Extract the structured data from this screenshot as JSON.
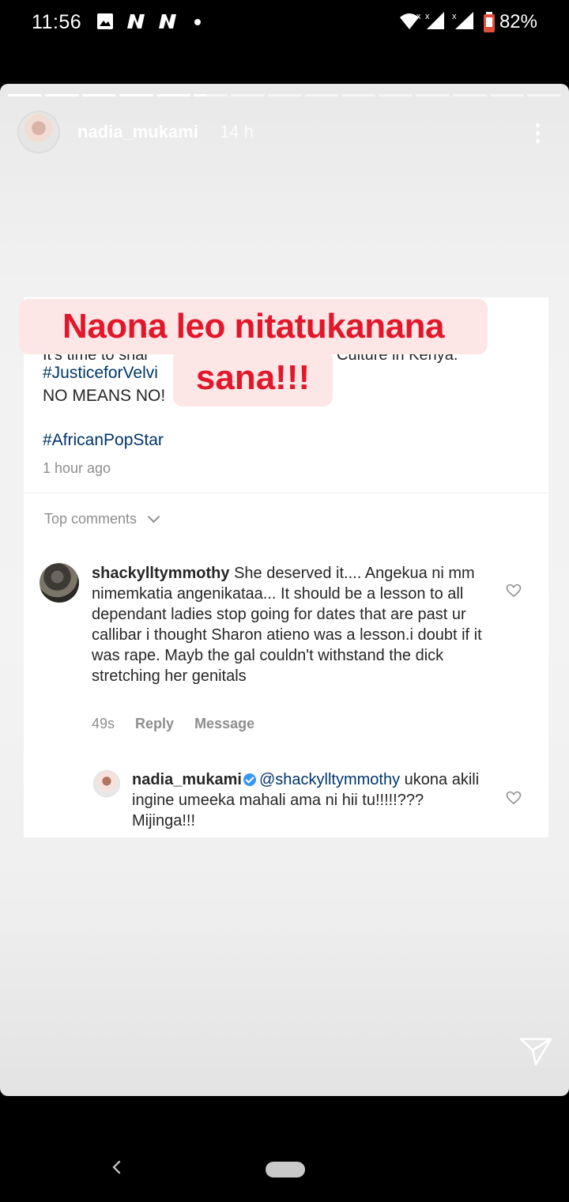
{
  "status_bar": {
    "time": "11:56",
    "battery": "82%",
    "icons": [
      "image-icon",
      "n-app-icon",
      "n-app-icon",
      "dot-icon",
      "wifi-icon",
      "signal-icon",
      "signal-icon",
      "battery-icon"
    ]
  },
  "story": {
    "progress": {
      "segments": 15,
      "completed": 5,
      "current_fill": 0.4
    },
    "username": "nadia_mukami",
    "time_ago": "14 h"
  },
  "post": {
    "hidden_line_left": "It's time to shar",
    "hidden_line_right": "Culture in Kenya.",
    "hashtag1": "#JusticeforVelvi",
    "no_means_no": "NO MEANS NO!",
    "hashtag2": "#AfricanPopStar",
    "time": "1 hour ago",
    "top_comments_label": "Top comments"
  },
  "comments": [
    {
      "username": "shackylltymmothy",
      "text": "She deserved it.... Angekua ni mm nimemkatia angenikataa... It should be a lesson to all dependant ladies stop going for dates that are past ur callibar i thought Sharon atieno was a lesson.i doubt if it was rape. Mayb the gal couldn't withstand the dick stretching her genitals",
      "time": "49s",
      "reply_label": "Reply",
      "message_label": "Message"
    },
    {
      "username": "nadia_mukami",
      "mention": "@shackylltymmothy",
      "text": "ukona akili ingine umeeka mahali ama ni hii tu!!!!!??? Mijinga!!!"
    }
  ],
  "sticker": {
    "line1": "Naona leo nitatukanana",
    "line2": "sana!!!"
  },
  "colors": {
    "sticker_text": "#e3162a",
    "sticker_bg": "#fde6e6",
    "link": "#003569",
    "verified": "#3897f0"
  }
}
